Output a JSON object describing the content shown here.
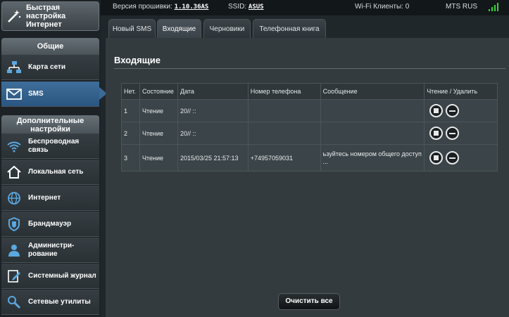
{
  "topbar": {
    "fw_label": "Версия прошивки:",
    "fw_value": "1.10.36AS",
    "ssid_label": "SSID:",
    "ssid_value": "ASUS",
    "wifi_clients": "Wi-Fi Клиенты: 0",
    "operator": "MTS RUS"
  },
  "sidebar": {
    "quick_setup": "Быстрая настройка Интернет",
    "general_header": "Общие",
    "general_items": [
      {
        "label": "Карта сети"
      },
      {
        "label": "SMS"
      }
    ],
    "advanced_header": "Дополнительные настройки",
    "advanced_items": [
      {
        "label": "Беспроводная связь"
      },
      {
        "label": "Локальная сеть"
      },
      {
        "label": "Интернет"
      },
      {
        "label": "Брандмауэр"
      },
      {
        "label": "Администри-рование"
      },
      {
        "label": "Системный журнал"
      },
      {
        "label": "Сетевые утилиты"
      }
    ]
  },
  "tabs": [
    {
      "label": "Новый SMS"
    },
    {
      "label": "Входящие"
    },
    {
      "label": "Черновики"
    },
    {
      "label": "Телефонная книга"
    }
  ],
  "panel": {
    "title": "Входящие",
    "columns": [
      "Нет.",
      "Состояние",
      "Дата",
      "Номер телефона",
      "Сообщение",
      "Чтение / Удалить"
    ],
    "rows": [
      {
        "num": "1",
        "status": "Чтение",
        "date": "20// ::",
        "phone": "",
        "message": ""
      },
      {
        "num": "2",
        "status": "Чтение",
        "date": "20// ::",
        "phone": "",
        "message": ""
      },
      {
        "num": "3",
        "status": "Чтение",
        "date": "2015/03/25 21:57:13",
        "phone": "+74957059031",
        "message": "ьзуйтесь номером общего доступ ..."
      }
    ],
    "clear_button": "Очистить все"
  },
  "colors": {
    "accent": "#2a5680",
    "panel": "#333b3f"
  }
}
